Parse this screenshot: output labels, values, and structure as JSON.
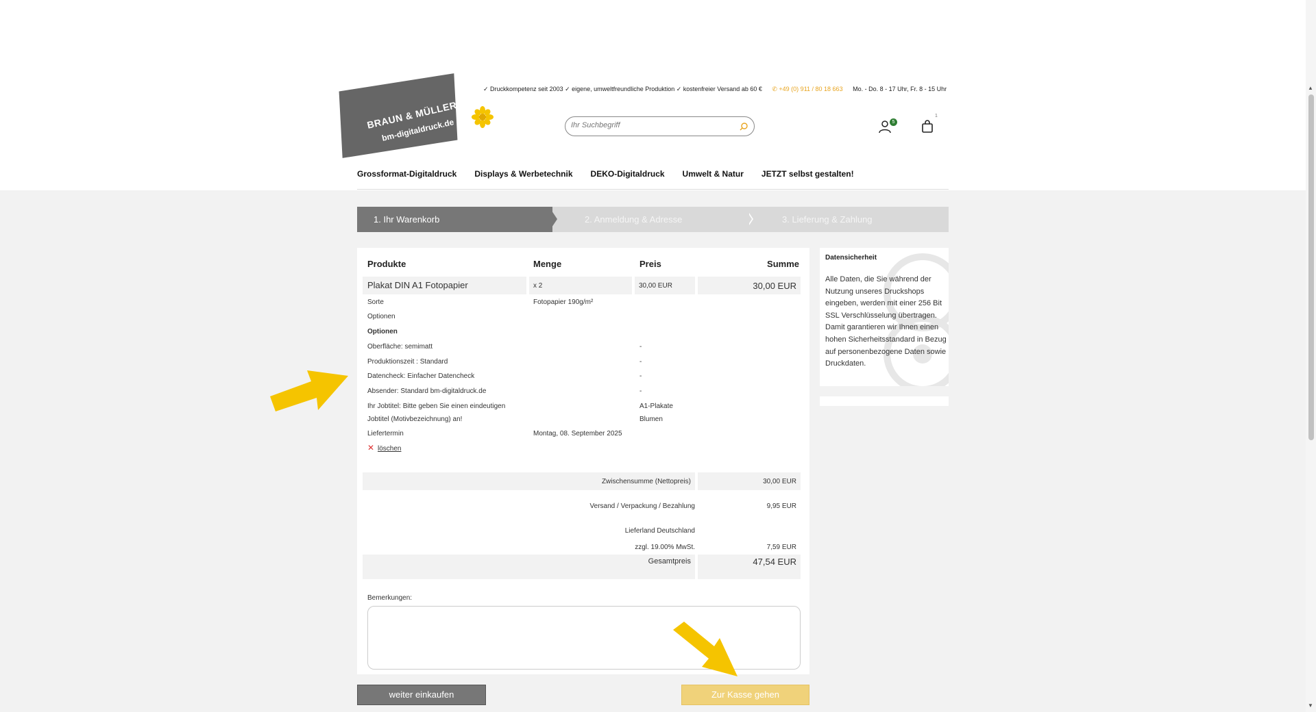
{
  "topbar": {
    "claims": "✓ Druckkompetenz seit 2003 ✓ eigene, umweltfreundliche Produktion ✓ kostenfreier Versand ab 60 €",
    "phone": "✆ +49 (0) 911 / 80 18 663",
    "hours": "Mo. - Do. 8 - 17 Uhr, Fr. 8 - 15 Uhr"
  },
  "logo": {
    "line1": "BRAUN & MÜLLER",
    "line2": "bm-digitaldruck.de"
  },
  "search": {
    "placeholder": "Ihr Suchbegriff"
  },
  "header": {
    "user_badge": "5",
    "cart_count": "1"
  },
  "nav": {
    "items": [
      "Grossformat-Digitaldruck",
      "Displays & Werbetechnik",
      "DEKO-Digitaldruck",
      "Umwelt & Natur",
      "JETZT selbst gestalten!"
    ]
  },
  "steps": {
    "step1": "1. Ihr Warenkorb",
    "step2": "2. Anmeldung & Adresse",
    "step3": "3. Lieferung & Zahlung"
  },
  "cart": {
    "headers": {
      "product": "Produkte",
      "quantity": "Menge",
      "price": "Preis",
      "sum": "Summe"
    },
    "item": {
      "name": "Plakat DIN A1 Fotopapier",
      "quantity": "x 2",
      "price": "30,00 EUR",
      "sum": "30,00 EUR",
      "sorte_label": "Sorte",
      "sorte_value": "Fotopapier 190g/m²",
      "optionen_label": "Optionen",
      "optionen_heading": "Optionen",
      "options": [
        {
          "label": "Oberfläche: semimatt",
          "value": "-"
        },
        {
          "label": "Produktionszeit : Standard",
          "value": "-"
        },
        {
          "label": "Datencheck: Einfacher Datencheck",
          "value": "-"
        },
        {
          "label": "Absender: Standard bm-digitaldruck.de",
          "value": "-"
        }
      ],
      "jobtitle_label_1": "Ihr Jobtitel: Bitte geben Sie einen eindeutigen",
      "jobtitle_label_2": "Jobtitel (Motivbezeichnung) an!",
      "jobtitle_value_1": "A1-Plakate",
      "jobtitle_value_2": "Blumen",
      "delivery_label": "Liefertermin",
      "delivery_value": "Montag, 08. September 2025",
      "delete_label": "löschen"
    },
    "totals": {
      "subtotal_label": "Zwischensumme (Nettopreis)",
      "subtotal_value": "30,00 EUR",
      "shipping_label": "Versand / Verpackung / Bezahlung",
      "shipping_value": "9,95 EUR",
      "country_label": "Lieferland Deutschland",
      "vat_label": "zzgl. 19.00% MwSt.",
      "vat_value": "7,59 EUR",
      "total_label": "Gesamtpreis",
      "total_value": "47,54 EUR"
    },
    "remarks_label": "Bemerkungen:"
  },
  "side": {
    "title": "Datensicherheit",
    "text": "Alle Daten, die Sie während der Nutzung unseres Druckshops eingeben, werden mit einer 256 Bit SSL Verschlüsselung übertragen. Damit garantieren wir Ihnen einen hohen Sicherheitsstandard in Bezug auf personenbezogene Daten sowie Druckdaten."
  },
  "buttons": {
    "continue": "weiter einkaufen",
    "checkout": "Zur Kasse gehen"
  },
  "colors": {
    "accent": "#f0d27a",
    "arrow": "#f5c400",
    "step_active": "#777777",
    "step_inactive": "#d9d9d9"
  }
}
